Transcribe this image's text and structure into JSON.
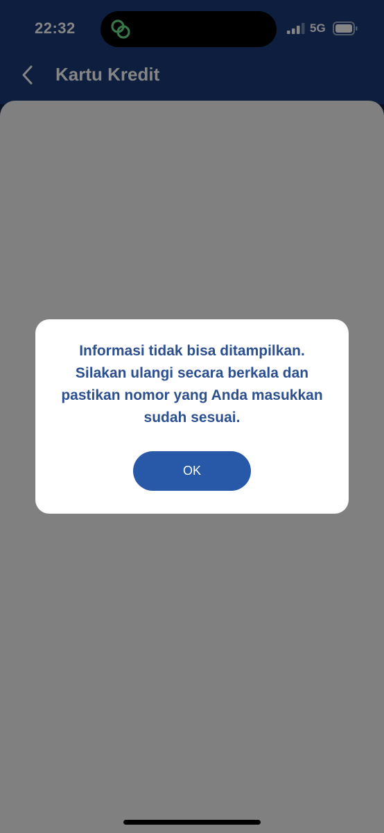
{
  "status_bar": {
    "time": "22:32",
    "network": "5G",
    "island_icon": "link-rings-icon",
    "signal_icon": "cellular-signal-icon",
    "battery_icon": "battery-icon"
  },
  "header": {
    "title": "Kartu Kredit",
    "back_icon": "chevron-left-icon"
  },
  "dialog": {
    "message": "Informasi tidak bisa ditampilkan. Silakan ulangi secara berkala dan pastikan nomor yang Anda masukkan sudah sesuai.",
    "ok_label": "OK"
  },
  "colors": {
    "header_bg": "#1a3b78",
    "accent": "#2858a8",
    "dialog_text": "#2b4f8f",
    "island_icon": "#6fe08a"
  }
}
